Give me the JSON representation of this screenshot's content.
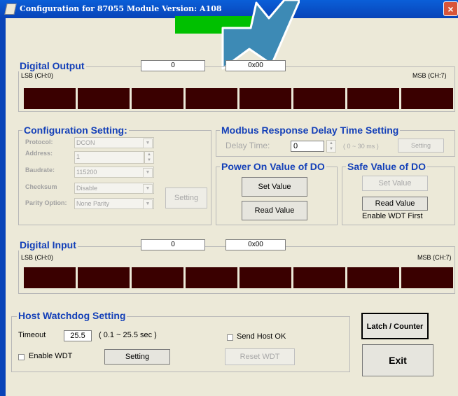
{
  "window": {
    "title": "Configuration for 87055 Module Version: A108",
    "close_glyph": "×"
  },
  "digital_output": {
    "title": "Digital Output",
    "value_dec": "0",
    "value_hex": "0x00",
    "lsb_label": "LSB (CH:0)",
    "msb_label": "MSB (CH:7)"
  },
  "config": {
    "title": "Configuration Setting:",
    "protocol_label": "Protocol:",
    "protocol_value": "DCON",
    "address_label": "Address:",
    "address_value": "1",
    "baudrate_label": "Baudrate:",
    "baudrate_value": "115200",
    "checksum_label": "Checksum",
    "checksum_value": "Disable",
    "parity_label": "Parity Option:",
    "parity_value": "None Parity",
    "setting_button": "Setting"
  },
  "modbus": {
    "title": "Modbus Response Delay Time Setting",
    "delay_label": "Delay Time:",
    "delay_value": "0",
    "range_hint": "( 0 ~ 30 ms )",
    "setting_button": "Setting"
  },
  "power_on": {
    "title": "Power On Value of DO",
    "set_button": "Set Value",
    "read_button": "Read Value"
  },
  "safe_value": {
    "title": "Safe Value of DO",
    "set_button": "Set Value",
    "read_button": "Read Value",
    "note": "Enable WDT First"
  },
  "digital_input": {
    "title": "Digital Input",
    "value_dec": "0",
    "value_hex": "0x00",
    "lsb_label": "LSB (CH:0)",
    "msb_label": "MSB (CH:7)"
  },
  "watchdog": {
    "title": "Host Watchdog Setting",
    "timeout_label": "Timeout",
    "timeout_value": "25.5",
    "range_hint": "( 0.1 ~ 25.5 sec )",
    "enable_wdt_label": "Enable WDT",
    "enable_wdt_checked": false,
    "setting_button": "Setting",
    "send_host_ok_label": "Send Host OK",
    "send_host_ok_checked": false,
    "reset_wdt_button": "Reset WDT"
  },
  "latch_button": "Latch / Counter",
  "exit_button": "Exit",
  "colors": {
    "accent": "#1440b8",
    "led_off": "#3a0000",
    "banner": "#00c000",
    "titlebar": "#0a5fd8"
  }
}
